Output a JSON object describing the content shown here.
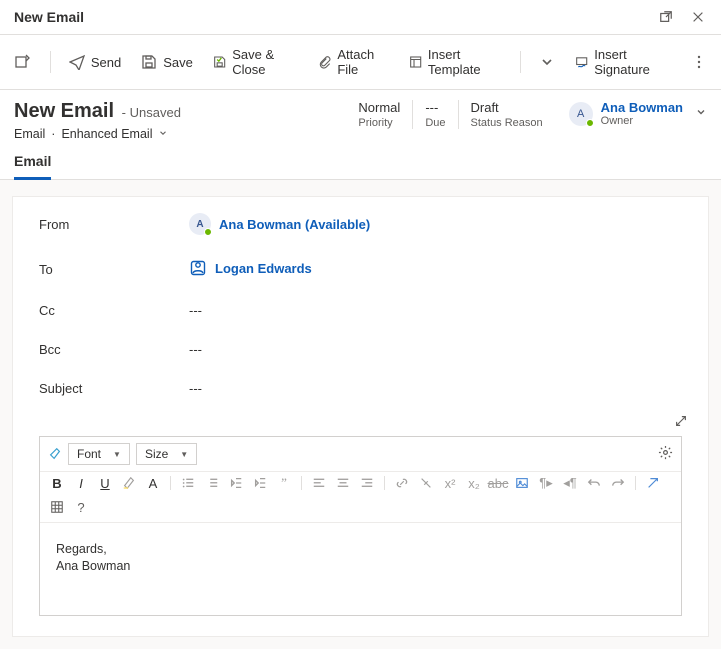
{
  "titlebar": {
    "title": "New Email"
  },
  "toolbar": {
    "send": "Send",
    "save": "Save",
    "save_close": "Save & Close",
    "attach": "Attach File",
    "insert_template": "Insert Template",
    "insert_signature": "Insert Signature"
  },
  "header": {
    "title": "New Email",
    "unsaved": "- Unsaved",
    "crumb1": "Email",
    "crumb2": "Enhanced Email",
    "stats": {
      "priority_val": "Normal",
      "priority_lab": "Priority",
      "due_val": "---",
      "due_lab": "Due",
      "status_val": "Draft",
      "status_lab": "Status Reason"
    },
    "owner": {
      "initial": "A",
      "name": "Ana Bowman",
      "role": "Owner"
    }
  },
  "tabs": {
    "email": "Email"
  },
  "form": {
    "from_label": "From",
    "from_initial": "A",
    "from_value": "Ana Bowman (Available)",
    "to_label": "To",
    "to_value": "Logan Edwards",
    "cc_label": "Cc",
    "cc_value": "---",
    "bcc_label": "Bcc",
    "bcc_value": "---",
    "subject_label": "Subject",
    "subject_value": "---"
  },
  "editor": {
    "font_dd": "Font",
    "size_dd": "Size",
    "body_line1": "Regards,",
    "body_line2": "Ana Bowman"
  }
}
